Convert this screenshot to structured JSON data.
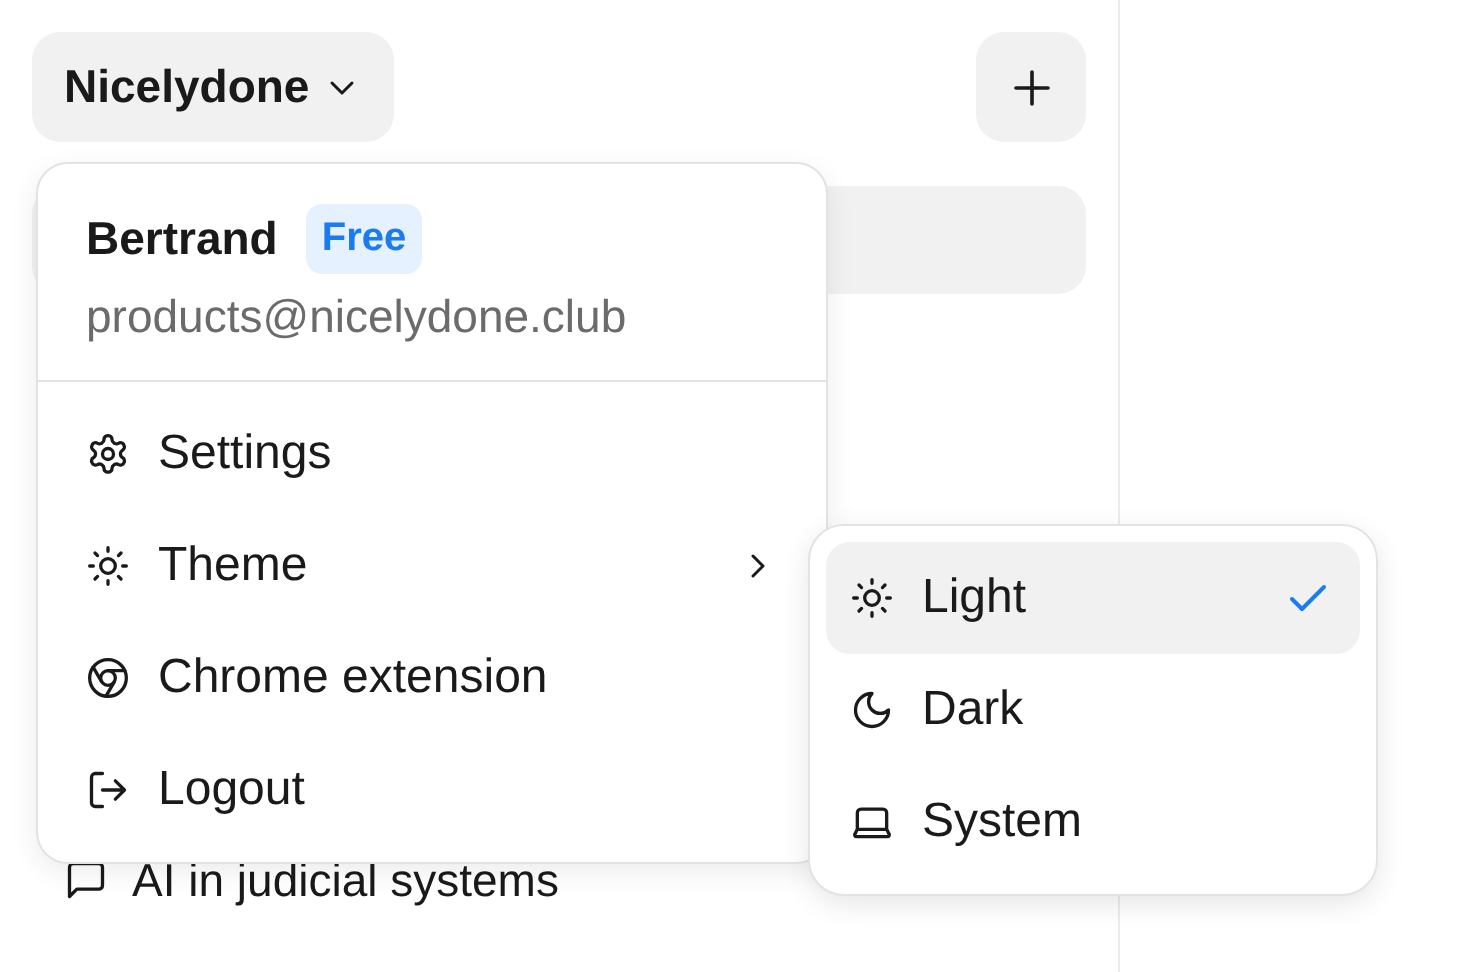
{
  "workspace": {
    "name": "Nicelydone"
  },
  "account": {
    "name": "Bertrand",
    "plan": "Free",
    "email": "products@nicelydone.club"
  },
  "menu": [
    {
      "label": "Settings",
      "kind": "settings"
    },
    {
      "label": "Theme",
      "kind": "theme"
    },
    {
      "label": "Chrome extension",
      "kind": "extension"
    },
    {
      "label": "Logout",
      "kind": "logout"
    }
  ],
  "theme_options": [
    {
      "label": "Light",
      "kind": "light",
      "selected": true
    },
    {
      "label": "Dark",
      "kind": "dark",
      "selected": false
    },
    {
      "label": "System",
      "kind": "system",
      "selected": false
    }
  ],
  "chats": [
    {
      "title": "AI in judicial systems"
    }
  ]
}
